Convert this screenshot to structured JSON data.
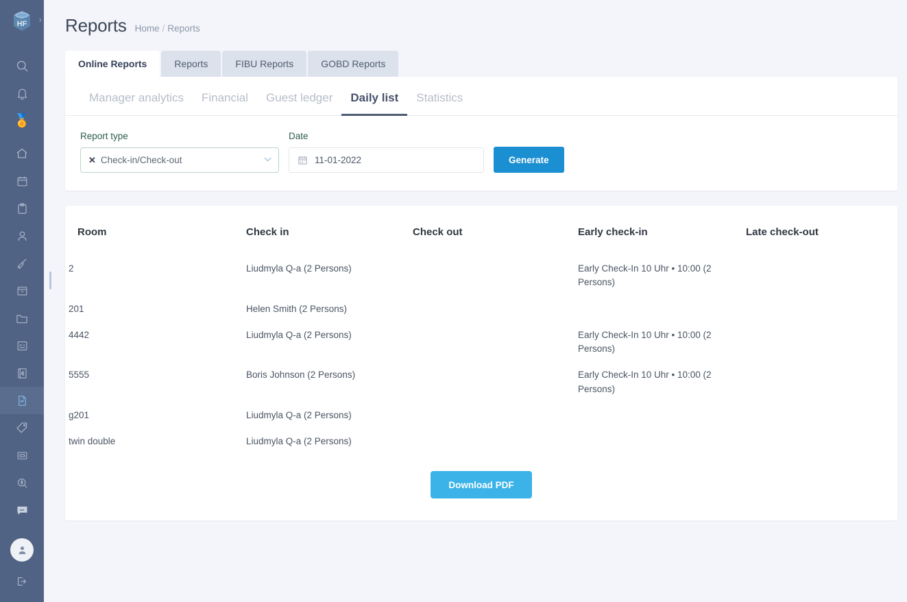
{
  "sidebar": {
    "logo": {
      "name": "hotelfriend-cube-logo",
      "letters": "HF",
      "expand": "›"
    },
    "items": [
      {
        "name": "search-icon",
        "label": "Search"
      },
      {
        "name": "bell-icon",
        "label": "Notifications"
      },
      {
        "name": "medal-icon",
        "label": "Awards",
        "glyph": "🏅"
      },
      {
        "name": "home-icon",
        "label": "Home"
      },
      {
        "name": "calendar-icon",
        "label": "Calendar"
      },
      {
        "name": "clipboard-icon",
        "label": "Tasks"
      },
      {
        "name": "user-icon",
        "label": "Guests"
      },
      {
        "name": "broom-icon",
        "label": "Housekeeping"
      },
      {
        "name": "window-icon",
        "label": "Rooms"
      },
      {
        "name": "folder-icon",
        "label": "Files"
      },
      {
        "name": "checklist-icon",
        "label": "Checklist"
      },
      {
        "name": "euro-document-icon",
        "label": "Invoices"
      },
      {
        "name": "report-chart-icon",
        "label": "Reports",
        "active": true
      },
      {
        "name": "tag-icon",
        "label": "Offers"
      },
      {
        "name": "inbox-icon",
        "label": "Inbox"
      },
      {
        "name": "search-dollar-icon",
        "label": "Revenue"
      },
      {
        "name": "chat-icon",
        "label": "Messages"
      },
      {
        "name": "avatar-icon",
        "label": "Profile"
      },
      {
        "name": "logout-icon",
        "label": "Log out"
      }
    ]
  },
  "header": {
    "title": "Reports",
    "breadcrumb": {
      "home": "Home",
      "separator": "/",
      "current": "Reports"
    }
  },
  "tabs": [
    {
      "label": "Online Reports",
      "active": true
    },
    {
      "label": "Reports",
      "active": false
    },
    {
      "label": "FIBU Reports",
      "active": false
    },
    {
      "label": "GOBD Reports",
      "active": false
    }
  ],
  "subtabs": [
    {
      "label": "Manager analytics",
      "active": false
    },
    {
      "label": "Financial",
      "active": false
    },
    {
      "label": "Guest ledger",
      "active": false
    },
    {
      "label": "Daily list",
      "active": true
    },
    {
      "label": "Statistics",
      "active": false
    }
  ],
  "form": {
    "report_type": {
      "label": "Report type",
      "value": "Check-in/Check-out",
      "clear_glyph": "✕",
      "chevron_glyph": "⌄"
    },
    "date": {
      "label": "Date",
      "value": "11-01-2022"
    },
    "generate_label": "Generate"
  },
  "report": {
    "columns": [
      "Room",
      "Check in",
      "Check out",
      "Early check-in",
      "Late check-out"
    ],
    "rows": [
      {
        "room": "2",
        "check_in": "Liudmyla Q-a (2 Persons)",
        "check_out": "",
        "early_check_in": "Early Check-In 10 Uhr • 10:00 (2 Persons)",
        "late_check_out": ""
      },
      {
        "room": "201",
        "check_in": "Helen Smith (2 Persons)",
        "check_out": "",
        "early_check_in": "",
        "late_check_out": ""
      },
      {
        "room": "4442",
        "check_in": "Liudmyla Q-a (2 Persons)",
        "check_out": "",
        "early_check_in": "Early Check-In 10 Uhr • 10:00 (2 Persons)",
        "late_check_out": ""
      },
      {
        "room": "5555",
        "check_in": "Boris Johnson (2 Persons)",
        "check_out": "",
        "early_check_in": "Early Check-In 10 Uhr • 10:00 (2 Persons)",
        "late_check_out": ""
      },
      {
        "room": "g201",
        "check_in": "Liudmyla Q-a (2 Persons)",
        "check_out": "",
        "early_check_in": "",
        "late_check_out": ""
      },
      {
        "room": "twin double",
        "check_in": "Liudmyla Q-a (2 Persons)",
        "check_out": "",
        "early_check_in": "",
        "late_check_out": ""
      }
    ],
    "download_label": "Download PDF"
  },
  "colors": {
    "sidebar_bg": "#516384",
    "page_bg": "#f4f5fa",
    "generate_blue": "#1a8fd1",
    "download_blue": "#3bb3e8",
    "label_green": "#2e5d4f",
    "active_subtab": "#4d5b73"
  }
}
